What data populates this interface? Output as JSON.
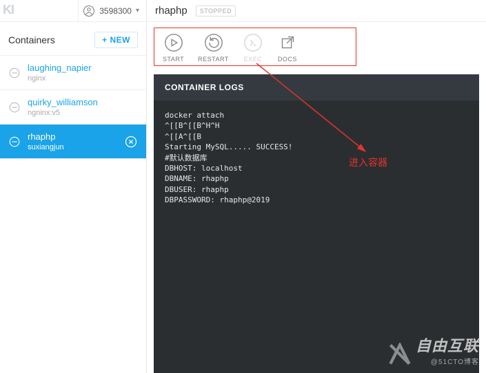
{
  "logo": "KI",
  "user": {
    "id": "3598300"
  },
  "sidebar": {
    "title": "Containers",
    "new_label": "+ NEW",
    "items": [
      {
        "name": "laughing_napier",
        "image": "nginx",
        "active": false
      },
      {
        "name": "quirky_williamson",
        "image": "ngninx:v5",
        "active": false
      },
      {
        "name": "rhaphp",
        "image": "suxiangjun",
        "active": true
      }
    ]
  },
  "header": {
    "title": "rhaphp",
    "status": "STOPPED"
  },
  "actions": {
    "start": "START",
    "restart": "RESTART",
    "exec": "EXEC",
    "docs": "DOCS"
  },
  "logs": {
    "title": "CONTAINER LOGS",
    "body": "docker attach\n^[[B^[[B^H^H\n^[[A^[[B\nStarting MySQL..... SUCCESS!\n#默认数据库\nDBHOST: localhost\nDBNAME: rhaphp\nDBUSER: rhaphp\nDBPASSWORD: rhaphp@2019"
  },
  "annotation": "进入容器",
  "watermark": {
    "brand": "自由互联",
    "sub": "@51CTO博客"
  }
}
